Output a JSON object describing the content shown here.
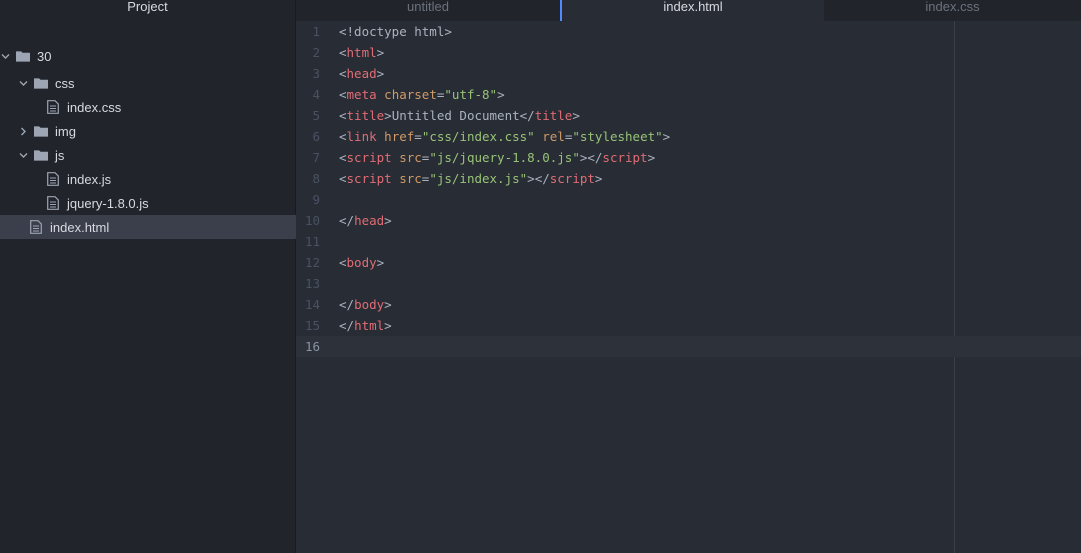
{
  "sidebar": {
    "title": "Project",
    "tree": [
      {
        "label": "30",
        "kind": "folder",
        "expanded": true,
        "depth": 0
      },
      {
        "label": "css",
        "kind": "folder",
        "expanded": true,
        "depth": 1
      },
      {
        "label": "index.css",
        "kind": "file",
        "depth": 2
      },
      {
        "label": "img",
        "kind": "folder",
        "expanded": false,
        "depth": 1
      },
      {
        "label": "js",
        "kind": "folder",
        "expanded": true,
        "depth": 1
      },
      {
        "label": "index.js",
        "kind": "file",
        "depth": 2
      },
      {
        "label": "jquery-1.8.0.js",
        "kind": "file",
        "depth": 2
      },
      {
        "label": "index.html",
        "kind": "file",
        "depth": 1,
        "selected": true
      }
    ]
  },
  "tabs": [
    {
      "label": "untitled",
      "active": false
    },
    {
      "label": "index.html",
      "active": true
    },
    {
      "label": "index.css",
      "active": false
    }
  ],
  "editor": {
    "lines": [
      {
        "num": "1",
        "tokens": [
          [
            "pun",
            "<!doctype html>"
          ]
        ]
      },
      {
        "num": "2",
        "tokens": [
          [
            "pun",
            "<"
          ],
          [
            "tag",
            "html"
          ],
          [
            "pun",
            ">"
          ]
        ]
      },
      {
        "num": "3",
        "tokens": [
          [
            "pun",
            "<"
          ],
          [
            "tag",
            "head"
          ],
          [
            "pun",
            ">"
          ]
        ]
      },
      {
        "num": "4",
        "tokens": [
          [
            "pun",
            "<"
          ],
          [
            "tag",
            "meta"
          ],
          [
            "pun",
            " "
          ],
          [
            "attr",
            "charset"
          ],
          [
            "pun",
            "="
          ],
          [
            "str",
            "\"utf-8\""
          ],
          [
            "pun",
            ">"
          ]
        ]
      },
      {
        "num": "5",
        "tokens": [
          [
            "pun",
            "<"
          ],
          [
            "tag",
            "title"
          ],
          [
            "pun",
            ">Untitled Document</"
          ],
          [
            "tag",
            "title"
          ],
          [
            "pun",
            ">"
          ]
        ]
      },
      {
        "num": "6",
        "tokens": [
          [
            "pun",
            "<"
          ],
          [
            "tag",
            "link"
          ],
          [
            "pun",
            " "
          ],
          [
            "attr",
            "href"
          ],
          [
            "pun",
            "="
          ],
          [
            "str",
            "\"css/index.css\""
          ],
          [
            "pun",
            " "
          ],
          [
            "attr",
            "rel"
          ],
          [
            "pun",
            "="
          ],
          [
            "str",
            "\"stylesheet\""
          ],
          [
            "pun",
            ">"
          ]
        ]
      },
      {
        "num": "7",
        "tokens": [
          [
            "pun",
            "<"
          ],
          [
            "tag",
            "script"
          ],
          [
            "pun",
            " "
          ],
          [
            "attr",
            "src"
          ],
          [
            "pun",
            "="
          ],
          [
            "str",
            "\"js/jquery-1.8.0.js\""
          ],
          [
            "pun",
            "></"
          ],
          [
            "tag",
            "script"
          ],
          [
            "pun",
            ">"
          ]
        ]
      },
      {
        "num": "8",
        "tokens": [
          [
            "pun",
            "<"
          ],
          [
            "tag",
            "script"
          ],
          [
            "pun",
            " "
          ],
          [
            "attr",
            "src"
          ],
          [
            "pun",
            "="
          ],
          [
            "str",
            "\"js/index.js\""
          ],
          [
            "pun",
            "></"
          ],
          [
            "tag",
            "script"
          ],
          [
            "pun",
            ">"
          ]
        ]
      },
      {
        "num": "9",
        "tokens": []
      },
      {
        "num": "10",
        "tokens": [
          [
            "pun",
            "</"
          ],
          [
            "tag",
            "head"
          ],
          [
            "pun",
            ">"
          ]
        ]
      },
      {
        "num": "11",
        "tokens": []
      },
      {
        "num": "12",
        "tokens": [
          [
            "pun",
            "<"
          ],
          [
            "tag",
            "body"
          ],
          [
            "pun",
            ">"
          ]
        ]
      },
      {
        "num": "13",
        "tokens": []
      },
      {
        "num": "14",
        "tokens": [
          [
            "pun",
            "</"
          ],
          [
            "tag",
            "body"
          ],
          [
            "pun",
            ">"
          ]
        ]
      },
      {
        "num": "15",
        "tokens": [
          [
            "pun",
            "</"
          ],
          [
            "tag",
            "html"
          ],
          [
            "pun",
            ">"
          ]
        ]
      },
      {
        "num": "16",
        "tokens": [],
        "cursor": true
      }
    ]
  },
  "colors": {
    "accent": "#528bff",
    "tag": "#e06c75",
    "attr": "#d19a66",
    "string": "#98c379"
  },
  "icons": {
    "folder": "folder-icon",
    "file": "file-icon",
    "expanded": "chevron-down-icon",
    "collapsed": "chevron-right-icon"
  }
}
